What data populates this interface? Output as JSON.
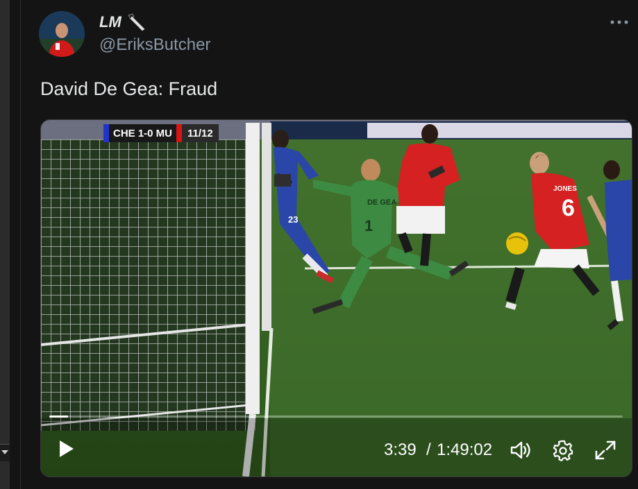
{
  "tweet": {
    "author_name": "LM",
    "author_emoji_icon": "kitchen-knife-icon",
    "author_handle": "@EriksButcher",
    "text": "David De Gea: Fraud"
  },
  "video": {
    "scorebug": {
      "score": "CHE 1-0 MU",
      "season": "11/12",
      "home_color": "#2233cc",
      "away_color": "#d81414"
    },
    "players": {
      "keeper_name": "DE GEA",
      "keeper_number": "1",
      "defender_name": "JONES",
      "defender_number": "6",
      "chelsea_number": "23"
    },
    "progress_fraction": 0.033,
    "time_current": "3:39",
    "time_separator": "/",
    "time_total": "1:49:02"
  },
  "colors": {
    "background": "#141414",
    "text_primary": "#e7e9ea",
    "text_secondary": "#8b98a5"
  }
}
